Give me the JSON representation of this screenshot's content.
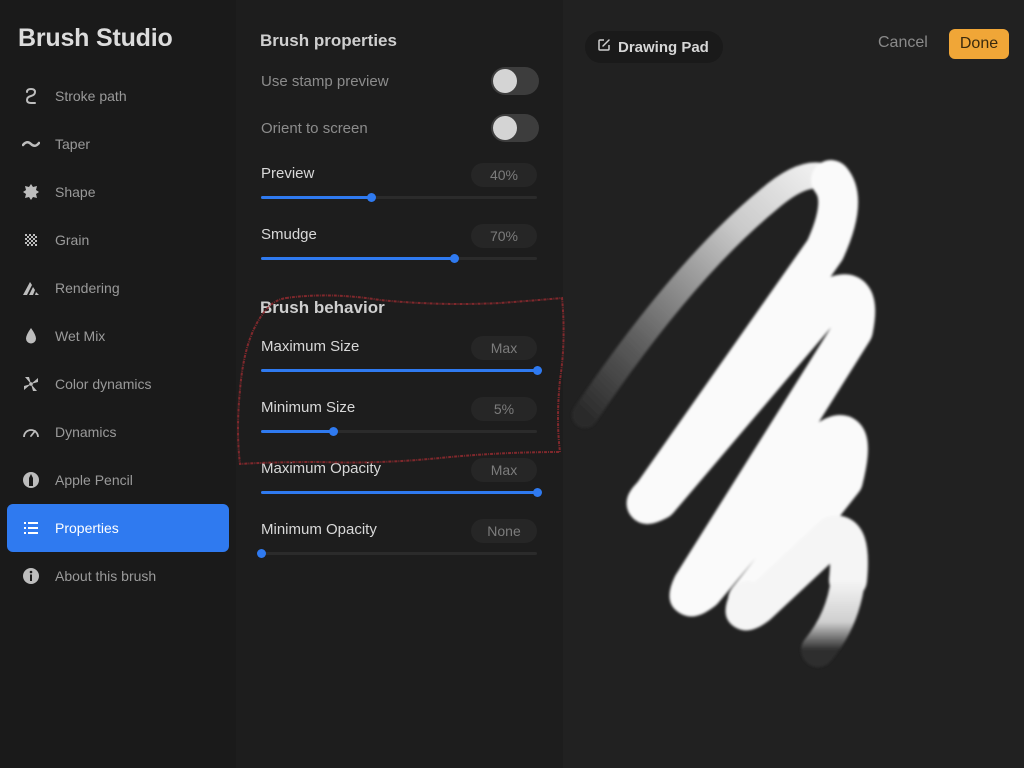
{
  "app": {
    "title": "Brush Studio"
  },
  "sidebar": {
    "items": [
      {
        "label": "Stroke path",
        "icon": "stroke-path-icon",
        "active": false
      },
      {
        "label": "Taper",
        "icon": "taper-icon",
        "active": false
      },
      {
        "label": "Shape",
        "icon": "shape-icon",
        "active": false
      },
      {
        "label": "Grain",
        "icon": "grain-icon",
        "active": false
      },
      {
        "label": "Rendering",
        "icon": "rendering-icon",
        "active": false
      },
      {
        "label": "Wet Mix",
        "icon": "wet-mix-icon",
        "active": false
      },
      {
        "label": "Color dynamics",
        "icon": "color-dynamics-icon",
        "active": false
      },
      {
        "label": "Dynamics",
        "icon": "dynamics-icon",
        "active": false
      },
      {
        "label": "Apple Pencil",
        "icon": "apple-pencil-icon",
        "active": false
      },
      {
        "label": "Properties",
        "icon": "list-icon",
        "active": true
      },
      {
        "label": "About this brush",
        "icon": "info-icon",
        "active": false
      }
    ]
  },
  "properties": {
    "brush_properties": {
      "title": "Brush properties",
      "toggles": [
        {
          "label": "Use stamp preview",
          "on": false
        },
        {
          "label": "Orient to screen",
          "on": false
        }
      ],
      "sliders": [
        {
          "label": "Preview",
          "value": "40%",
          "fraction": 0.4
        },
        {
          "label": "Smudge",
          "value": "70%",
          "fraction": 0.7
        }
      ]
    },
    "brush_behavior": {
      "title": "Brush behavior",
      "sliders": [
        {
          "label": "Maximum Size",
          "value": "Max",
          "fraction": 1.0
        },
        {
          "label": "Minimum Size",
          "value": "5%",
          "fraction": 0.26
        },
        {
          "label": "Maximum Opacity",
          "value": "Max",
          "fraction": 1.0
        },
        {
          "label": "Minimum Opacity",
          "value": "None",
          "fraction": 0.0
        }
      ]
    }
  },
  "drawing_pad": {
    "title": "Drawing Pad",
    "cancel_label": "Cancel",
    "done_label": "Done"
  },
  "colors": {
    "accent": "#2f7af0",
    "done_button": "#f0a637",
    "annotation": "#8b2a2f"
  }
}
